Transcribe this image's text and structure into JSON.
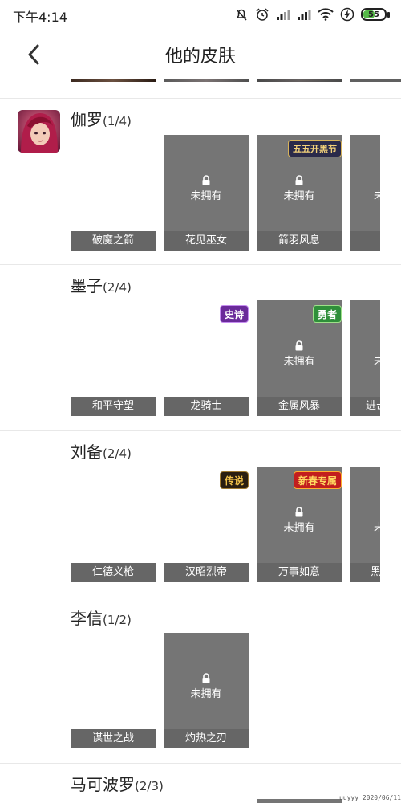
{
  "status_bar": {
    "time": "下午4:14",
    "battery_level": "55",
    "battery_fraction": 0.55,
    "icons": [
      "mute-icon",
      "alarm-icon",
      "signal-icon",
      "signal-icon",
      "wifi-icon",
      "charging-icon",
      "battery-icon"
    ]
  },
  "nav": {
    "title": "他的皮肤",
    "back_icon": "back-chevron-icon"
  },
  "colors": {
    "locked_card": "#757575",
    "label_bg": "#666666",
    "divider": "#e8e8e8",
    "battery_green": "#55b948"
  },
  "heroes": [
    {
      "name": "伽罗",
      "count": "(1/4)",
      "skins": [
        {
          "name": "破魔之箭",
          "owned": true,
          "badge": "",
          "lock_text": ""
        },
        {
          "name": "花见巫女",
          "owned": false,
          "badge": "",
          "lock_text": "未拥有"
        },
        {
          "name": "箭羽风息",
          "owned": false,
          "badge": "五五开黑节",
          "lock_text": "未拥有"
        },
        {
          "name": "",
          "owned": false,
          "badge": "",
          "lock_text": "未"
        }
      ]
    },
    {
      "name": "墨子",
      "count": "(2/4)",
      "skins": [
        {
          "name": "和平守望",
          "owned": true,
          "badge": "",
          "lock_text": ""
        },
        {
          "name": "龙骑士",
          "owned": true,
          "badge": "史诗",
          "lock_text": ""
        },
        {
          "name": "金属风暴",
          "owned": false,
          "badge": "勇者",
          "lock_text": "未拥有"
        },
        {
          "name": "进击",
          "owned": false,
          "badge": "",
          "lock_text": "未"
        }
      ]
    },
    {
      "name": "刘备",
      "count": "(2/4)",
      "skins": [
        {
          "name": "仁德义枪",
          "owned": true,
          "badge": "",
          "lock_text": ""
        },
        {
          "name": "汉昭烈帝",
          "owned": true,
          "badge": "传说",
          "lock_text": ""
        },
        {
          "name": "万事如意",
          "owned": false,
          "badge": "新春专属",
          "lock_text": "未拥有"
        },
        {
          "name": "黑",
          "owned": false,
          "badge": "",
          "lock_text": "未"
        }
      ]
    },
    {
      "name": "李信",
      "count": "(1/2)",
      "skins": [
        {
          "name": "谋世之战",
          "owned": true,
          "badge": "",
          "lock_text": ""
        },
        {
          "name": "灼热之刃",
          "owned": false,
          "badge": "",
          "lock_text": "未拥有"
        }
      ]
    },
    {
      "name": "马可波罗",
      "count": "(2/3)",
      "skins": []
    }
  ],
  "watermark": "uuyyy 2020/06/11"
}
